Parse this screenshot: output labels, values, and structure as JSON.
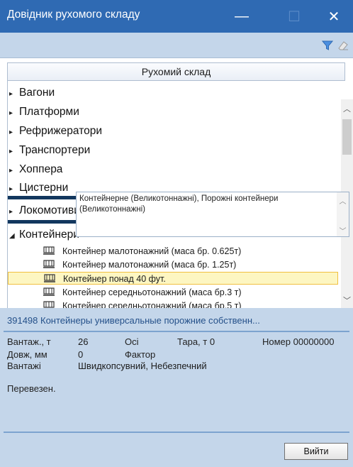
{
  "window": {
    "title": "Довідник рухомого складу",
    "minimize_glyph": "—",
    "maximize_glyph": "☐",
    "close_glyph": "✕"
  },
  "toolbar": {
    "filter_icon": "filter-icon",
    "clear_icon": "eraser-icon",
    "accent": "#2f6ab3"
  },
  "grid": {
    "header": "Рухомий склад"
  },
  "tree": {
    "groups_top": [
      {
        "label": "Вагони"
      },
      {
        "label": "Платформи"
      },
      {
        "label": "Рефрижератори"
      },
      {
        "label": "Транспортери"
      },
      {
        "label": "Хоппера"
      },
      {
        "label": "Цистерни"
      }
    ],
    "group_loco": {
      "label": "Локомотиви і ін. обладнання"
    },
    "group_containers": {
      "label": "Контейнери"
    },
    "container_items": [
      {
        "label": "Контейнер малотонажний (маса бр. 0.625т)"
      },
      {
        "label": "Контейнер малотонажний (маса бр. 1.25т)"
      },
      {
        "label": "Контейнер понад 40 фут.",
        "selected": true
      },
      {
        "label": "Контейнер середньотонажний (маса бр.3 т)"
      },
      {
        "label": "Контейнер середньотонажний (маса бр.5 т)"
      }
    ]
  },
  "details": {
    "title": "391498 Контейнеры универсальные порожние собственн...",
    "cargo_label": "Вантаж., т",
    "cargo_value": "26",
    "axles_label": "Осі",
    "tare_label": "Тара, т 0",
    "number_label": "Номер 00000000",
    "length_label": "Довж, мм",
    "length_value": "0",
    "factor_label": "Фактор",
    "loads_label": "Вантажі",
    "loads_value": "Швидкопсувний, Небезпечний",
    "transport_label": "Перевезен.",
    "transport_value": "Контейнерне (Великотоннажні), Порожні контейнери (Великотоннажні)"
  },
  "buttons": {
    "exit": "Вийти"
  }
}
